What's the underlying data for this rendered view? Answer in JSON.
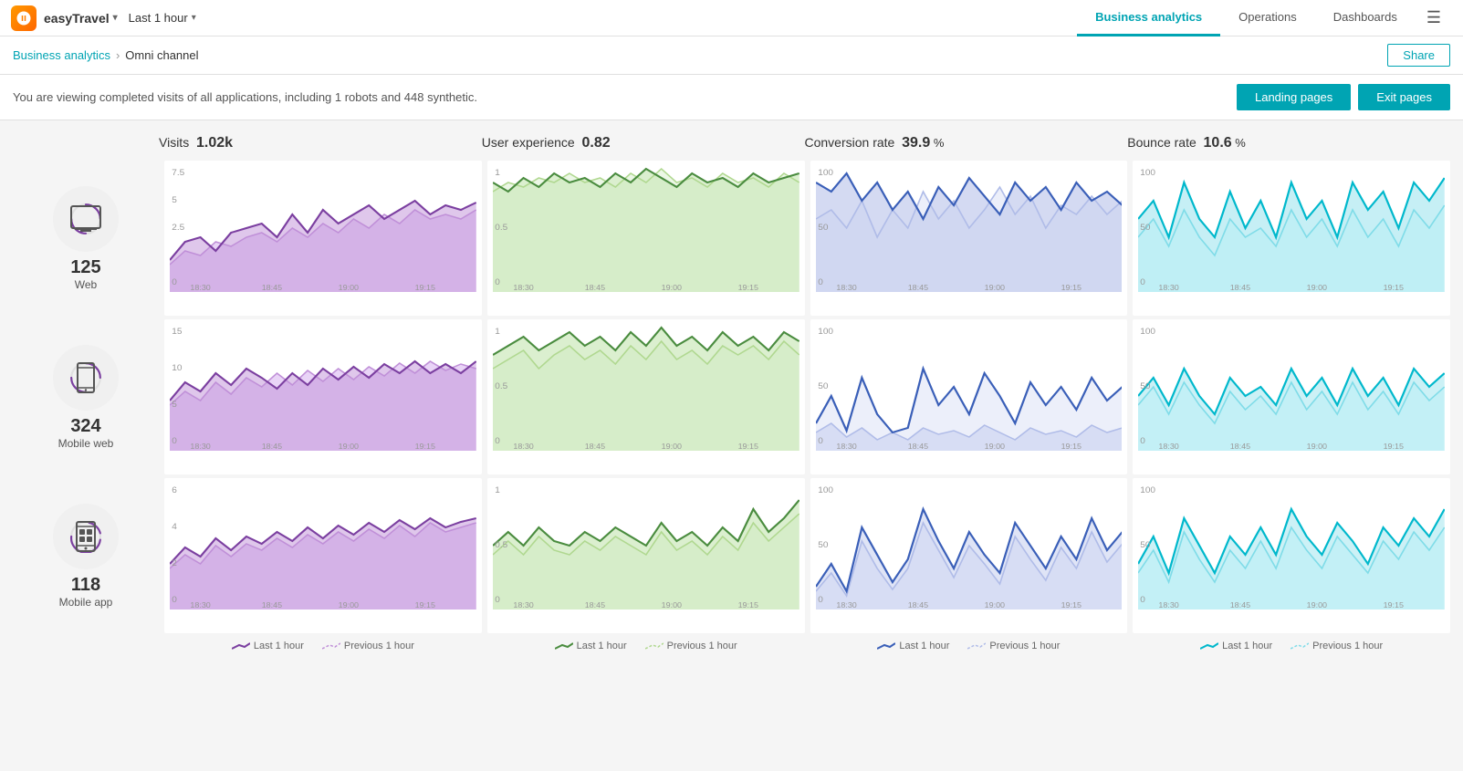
{
  "app": {
    "logo_alt": "easyTravel logo",
    "name": "easyTravel",
    "time_range": "Last 1 hour",
    "nav_tabs": [
      {
        "label": "Business analytics",
        "active": true
      },
      {
        "label": "Operations",
        "active": false
      },
      {
        "label": "Dashboards",
        "active": false
      }
    ],
    "menu_icon": "☰"
  },
  "breadcrumb": {
    "parent": "Business analytics",
    "current": "Omni channel"
  },
  "share_button": "Share",
  "info_text": "You are viewing completed visits of all applications, including 1 robots and 448 synthetic.",
  "buttons": {
    "landing_pages": "Landing pages",
    "exit_pages": "Exit pages"
  },
  "metrics": {
    "visits": {
      "label": "Visits",
      "value": "1.02k"
    },
    "user_experience": {
      "label": "User experience",
      "value": "0.82"
    },
    "conversion_rate": {
      "label": "Conversion rate",
      "value": "39.9",
      "unit": "%"
    },
    "bounce_rate": {
      "label": "Bounce rate",
      "value": "10.6",
      "unit": "%"
    }
  },
  "channels": [
    {
      "name": "Web",
      "count": "125",
      "icon": "web"
    },
    {
      "name": "Mobile web",
      "count": "324",
      "icon": "mobile"
    },
    {
      "name": "Mobile app",
      "count": "118",
      "icon": "mobileapp"
    }
  ],
  "time_labels": [
    "18:30",
    "18:45",
    "19:00",
    "19:15"
  ],
  "legend": {
    "last_hour": "Last 1 hour",
    "previous_hour": "Previous 1 hour"
  },
  "colors": {
    "visits_line": "#7b3fa0",
    "visits_fill": "#c8a0dc",
    "visits_prev_line": "#c8a0dc",
    "ux_line": "#4a8c3f",
    "ux_fill": "#b8e0a0",
    "ux_prev_line": "#b8e0a0",
    "conv_line": "#3a5fb8",
    "conv_fill": "#b0bce8",
    "conv_prev_line": "#b0bce8",
    "bounce_line": "#00b8cc",
    "bounce_fill": "#80dce8",
    "bounce_prev_line": "#80dce8",
    "teal": "#00a4b3"
  }
}
